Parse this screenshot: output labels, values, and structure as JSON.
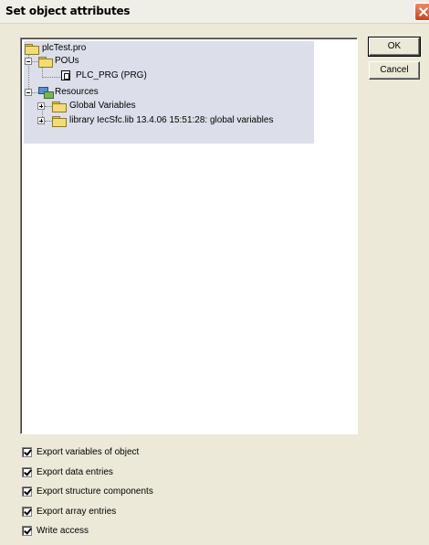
{
  "window": {
    "title": "Set object attributes"
  },
  "buttons": {
    "ok": "OK",
    "cancel": "Cancel"
  },
  "tree": {
    "root": "plcTest.pro",
    "pous": "POUs",
    "plc_prg": "PLC_PRG (PRG)",
    "resources": "Resources",
    "global_vars": "Global Variables",
    "library": "library IecSfc.lib 13.4.06 15:51:28: global variables"
  },
  "options": [
    {
      "label": "Export variables of object",
      "checked": true
    },
    {
      "label": "Export data entries",
      "checked": true
    },
    {
      "label": "Export structure components",
      "checked": true
    },
    {
      "label": "Export array entries",
      "checked": true
    },
    {
      "label": "Write access",
      "checked": true
    }
  ]
}
